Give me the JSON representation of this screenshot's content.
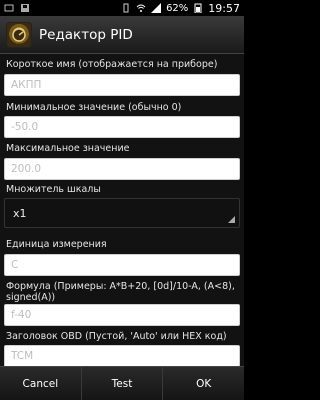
{
  "status_bar": {
    "battery": "62%",
    "time": "19:57"
  },
  "title_bar": {
    "title": "Редактор PID"
  },
  "fields": {
    "short_name_label": "Короткое имя (отображается на приборе)",
    "short_name_value": "АКПП",
    "min_label": "Минимальное значение (обычно 0)",
    "min_value": "-50.0",
    "max_label": "Максимальное значение",
    "max_value": "200.0",
    "scale_label": "Множитель шкалы",
    "scale_value": "x1",
    "unit_label": "Единица измерения",
    "unit_value": "C",
    "formula_label": "Формула (Примеры: A*B+20, [0d]/10-A, (A<8), signed(A))",
    "formula_value": "f-40",
    "obd_header_label": "Заголовок OBD (Пустой, 'Auto' или HEX код)",
    "obd_header_value": "TCM"
  },
  "buttons": {
    "cancel": "Cancel",
    "test": "Test",
    "ok": "OK"
  }
}
